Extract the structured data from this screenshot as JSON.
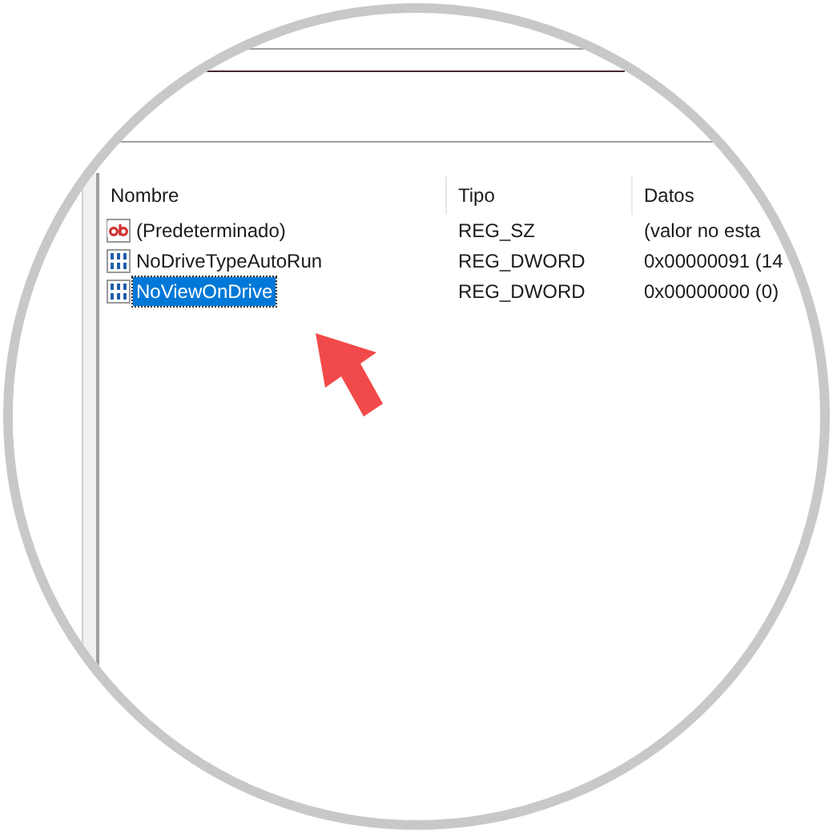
{
  "list": {
    "columns": [
      "Nombre",
      "Tipo",
      "Datos"
    ],
    "rows": [
      {
        "kind": "string",
        "name": "(Predeterminado)",
        "type": "REG_SZ",
        "data": "(valor no esta",
        "selected": false
      },
      {
        "kind": "dword",
        "name": "NoDriveTypeAutoRun",
        "type": "REG_DWORD",
        "data": "0x00000091 (14",
        "selected": false
      },
      {
        "kind": "dword",
        "name": "NoViewOnDrive",
        "type": "REG_DWORD",
        "data": "0x00000000 (0)",
        "selected": true
      }
    ]
  }
}
